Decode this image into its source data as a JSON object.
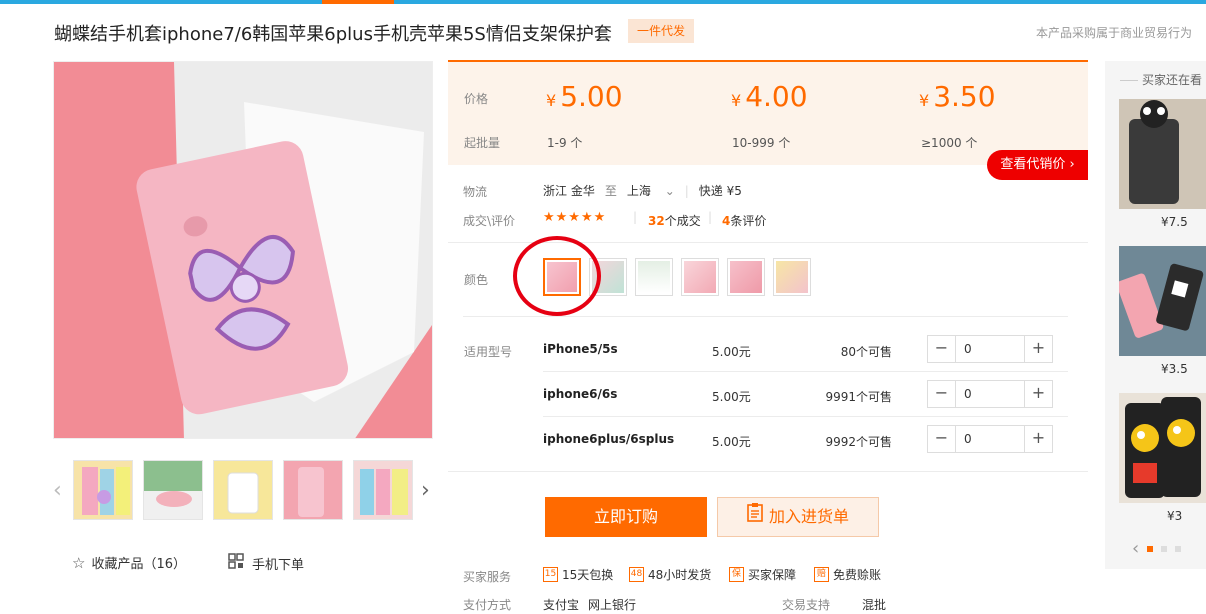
{
  "product": {
    "title": "蝴蝶结手机套iphone7/6韩国苹果6plus手机壳苹果5S情侣支架保护套",
    "badge": "一件代发",
    "legal_note": "本产品采购属于商业贸易行为"
  },
  "pricing": {
    "price_label": "价格",
    "min_qty_label": "起批量",
    "currency": "¥",
    "tiers": [
      {
        "price": "5.00",
        "qty": "1-9 个"
      },
      {
        "price": "4.00",
        "qty": "10-999 个"
      },
      {
        "price": "3.50",
        "qty": "≥1000 个"
      }
    ],
    "agent_price_button": "查看代销价"
  },
  "logistics": {
    "label": "物流",
    "from": "浙江 金华",
    "to_word": "至",
    "to": "上海",
    "shipping": "快递 ¥5"
  },
  "deals": {
    "label": "成交\\评价",
    "stars": "★★★★★",
    "deal_count": "32",
    "deal_suffix": "个成交",
    "review_count": "4",
    "review_suffix": "条评价"
  },
  "color": {
    "label": "颜色",
    "swatches": [
      {
        "name": "粉色蝴蝶结",
        "hex": "#f4a7b3"
      },
      {
        "name": "绿色款",
        "hex": "#bfe3d6"
      },
      {
        "name": "白色款",
        "hex": "#e8f0e8"
      },
      {
        "name": "粉白款",
        "hex": "#f6c4cc"
      },
      {
        "name": "粉红款",
        "hex": "#f3b1bb"
      },
      {
        "name": "黄色款",
        "hex": "#f7e6a5"
      }
    ],
    "selected_index": 0
  },
  "models": {
    "label": "适用型号",
    "rows": [
      {
        "name": "iPhone5/5s",
        "price": "5.00元",
        "stock": "80个可售",
        "qty": "0"
      },
      {
        "name": "iphone6/6s",
        "price": "5.00元",
        "stock": "9991个可售",
        "qty": "0"
      },
      {
        "name": "iphone6plus/6splus",
        "price": "5.00元",
        "stock": "9992个可售",
        "qty": "0"
      }
    ]
  },
  "actions": {
    "order": "立即订购",
    "add_to_list": "加入进货单",
    "favorite": "收藏产品（16）",
    "mobile_order": "手机下单"
  },
  "services": {
    "label": "买家服务",
    "items": [
      {
        "icon": "15",
        "text": "15天包换"
      },
      {
        "icon": "48",
        "text": "48小时发货"
      },
      {
        "icon": "保",
        "text": "买家保障"
      },
      {
        "icon": "赔",
        "text": "免费赊账"
      }
    ]
  },
  "payment": {
    "label": "支付方式",
    "methods": [
      "支付宝",
      "网上银行"
    ],
    "trade_label": "交易支持",
    "trade_value": "混批"
  },
  "sidebar": {
    "title": "买家还在看",
    "items": [
      {
        "price": "¥7.5",
        "color": "#3a3a3a"
      },
      {
        "price": "¥3.5",
        "color": "#5c7a8a"
      },
      {
        "price": "¥3",
        "color": "#f2c318"
      }
    ]
  },
  "colors": {
    "accent": "#ff6a00",
    "top_bar": "#2aa8e0",
    "red": "#e60012"
  }
}
